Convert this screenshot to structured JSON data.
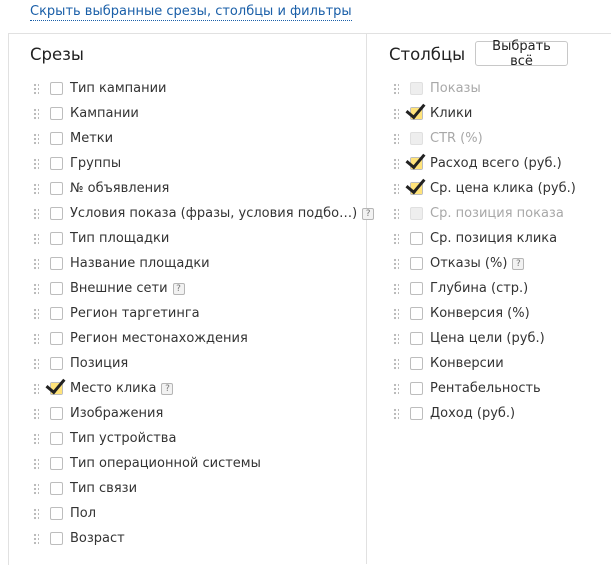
{
  "top_link": "Скрыть выбранные срезы, столбцы и фильтры",
  "slices": {
    "heading": "Срезы",
    "items": [
      {
        "label": "Тип кампании",
        "checked": false
      },
      {
        "label": "Кампании",
        "checked": false
      },
      {
        "label": "Метки",
        "checked": false
      },
      {
        "label": "Группы",
        "checked": false
      },
      {
        "label": "№ объявления",
        "checked": false
      },
      {
        "label": "Условия показа (фразы, условия подбо…)",
        "checked": false,
        "help": "?"
      },
      {
        "label": "Тип площадки",
        "checked": false
      },
      {
        "label": "Название площадки",
        "checked": false
      },
      {
        "label": "Внешние сети",
        "checked": false,
        "help": "?"
      },
      {
        "label": "Регион таргетинга",
        "checked": false
      },
      {
        "label": "Регион местонахождения",
        "checked": false
      },
      {
        "label": "Позиция",
        "checked": false
      },
      {
        "label": "Место клика",
        "checked": true,
        "help": "?"
      },
      {
        "label": "Изображения",
        "checked": false
      },
      {
        "label": "Тип устройства",
        "checked": false
      },
      {
        "label": "Тип операционной системы",
        "checked": false
      },
      {
        "label": "Тип связи",
        "checked": false
      },
      {
        "label": "Пол",
        "checked": false
      },
      {
        "label": "Возраст",
        "checked": false
      }
    ]
  },
  "columns": {
    "heading": "Столбцы",
    "select_all_label": "Выбрать всё",
    "items": [
      {
        "label": "Показы",
        "checked": false,
        "disabled": true
      },
      {
        "label": "Клики",
        "checked": true
      },
      {
        "label": "CTR (%)",
        "checked": false,
        "disabled": true
      },
      {
        "label": "Расход всего (руб.)",
        "checked": true
      },
      {
        "label": "Ср. цена клика (руб.)",
        "checked": true
      },
      {
        "label": "Ср. позиция показа",
        "checked": false,
        "disabled": true
      },
      {
        "label": "Ср. позиция клика",
        "checked": false
      },
      {
        "label": "Отказы (%)",
        "checked": false,
        "help": "?"
      },
      {
        "label": "Глубина (стр.)",
        "checked": false
      },
      {
        "label": "Конверсия (%)",
        "checked": false
      },
      {
        "label": "Цена цели (руб.)",
        "checked": false
      },
      {
        "label": "Конверсии",
        "checked": false
      },
      {
        "label": "Рентабельность",
        "checked": false
      },
      {
        "label": "Доход (руб.)",
        "checked": false
      }
    ]
  }
}
